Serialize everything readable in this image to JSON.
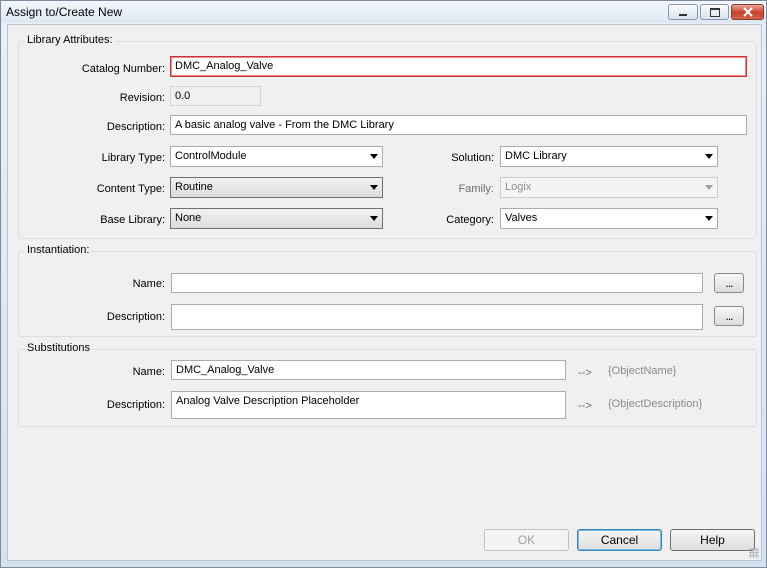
{
  "window": {
    "title": "Assign to/Create New"
  },
  "library_attributes": {
    "group_label": "Library Attributes:",
    "catalog_number_label": "Catalog Number:",
    "catalog_number_value": "DMC_Analog_Valve",
    "revision_label": "Revision:",
    "revision_value": "0.0",
    "description_label": "Description:",
    "description_value": "A basic analog valve - From the DMC Library",
    "library_type_label": "Library Type:",
    "library_type_value": "ControlModule",
    "content_type_label": "Content Type:",
    "content_type_value": "Routine",
    "base_library_label": "Base Library:",
    "base_library_value": "None",
    "solution_label": "Solution:",
    "solution_value": "DMC Library",
    "family_label": "Family:",
    "family_value": "Logix",
    "category_label": "Category:",
    "category_value": "Valves"
  },
  "instantiation": {
    "group_label": "Instantiation:",
    "name_label": "Name:",
    "name_value": "",
    "description_label": "Description:",
    "description_value": "",
    "browse_label": "..."
  },
  "substitutions": {
    "group_label": "Substitutions",
    "name_label": "Name:",
    "name_value": "DMC_Analog_Valve",
    "name_arrow": "-->",
    "name_token": "{ObjectName}",
    "description_label": "Description:",
    "description_value": "Analog Valve Description Placeholder",
    "description_arrow": "-->",
    "description_token": "{ObjectDescription}"
  },
  "buttons": {
    "ok": "OK",
    "cancel": "Cancel",
    "help": "Help"
  }
}
